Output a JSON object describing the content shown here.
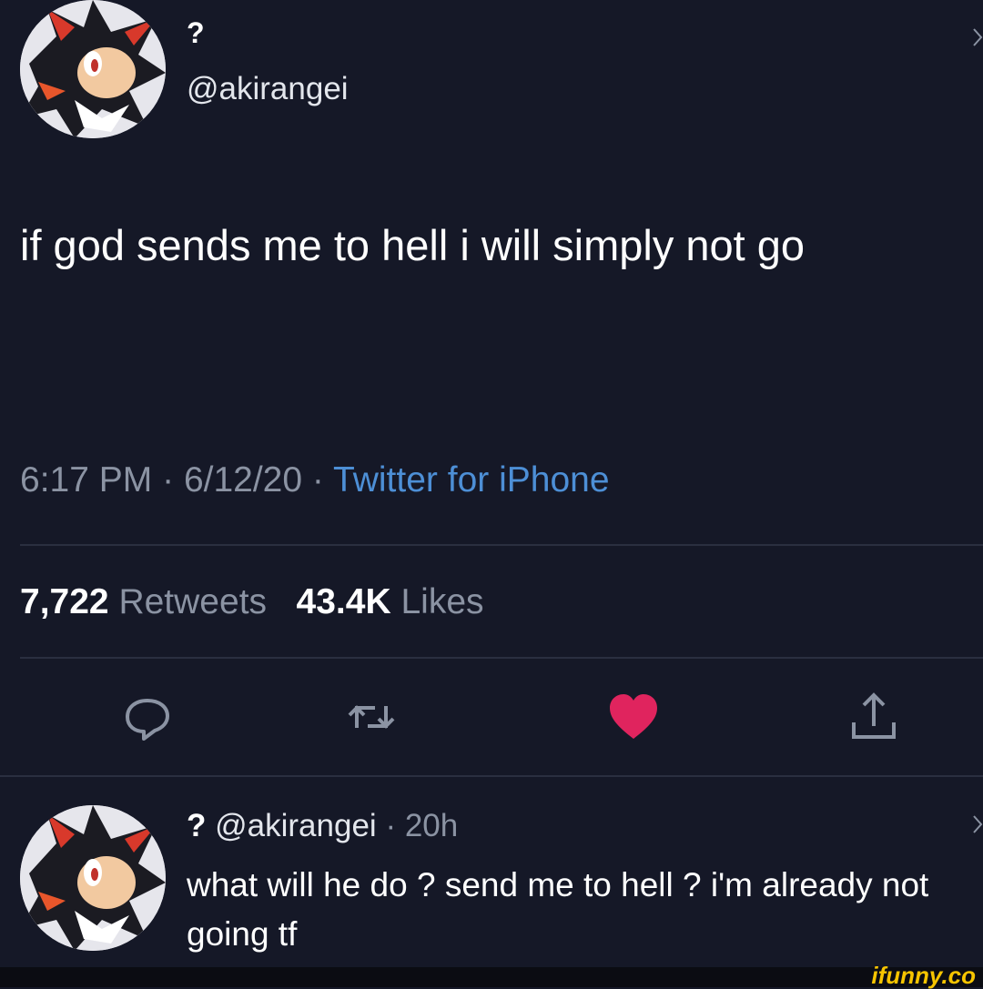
{
  "tweet": {
    "display_name": "?",
    "handle": "@akirangei",
    "text": "if god sends me to hell i will simply not go",
    "time": "6:17 PM",
    "date": "6/12/20",
    "separator": "·",
    "source": "Twitter for iPhone",
    "retweets_count": "7,722",
    "retweets_label": "Retweets",
    "likes_count": "43.4K",
    "likes_label": "Likes"
  },
  "actions": {
    "reply_icon": "reply-icon",
    "retweet_icon": "retweet-icon",
    "like_icon": "heart-icon",
    "share_icon": "share-icon",
    "like_color": "#e0245e"
  },
  "reply": {
    "display_name": "?",
    "handle": "@akirangei",
    "time": "20h",
    "separator": "·",
    "text": "what will he do ? send me to hell ? i'm already not going tf"
  },
  "watermark": "ifunny.co",
  "colors": {
    "background": "#151827",
    "muted": "#8b93a3",
    "link": "#4d8fd6",
    "watermark": "#f6c400"
  }
}
